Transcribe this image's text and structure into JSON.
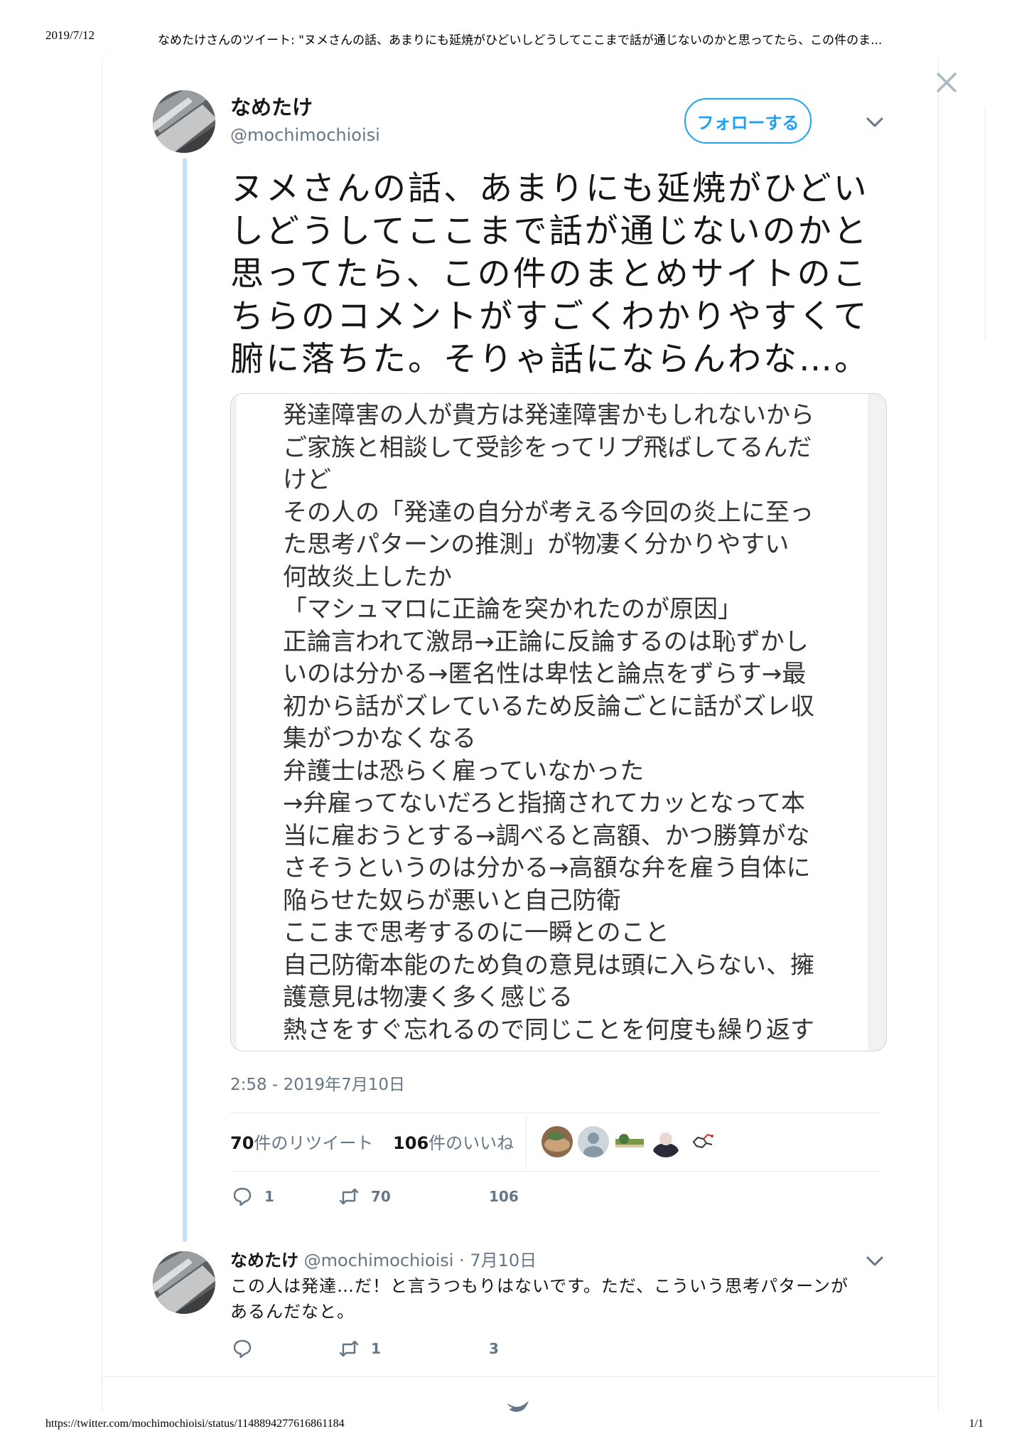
{
  "print_header": {
    "date": "2019/7/12",
    "title": "なめたけさんのツイート: \"ヌメさんの話、あまりにも延焼がひどいしどうしてここまで話が通じないのかと思ってたら、この件のま..."
  },
  "print_footer": {
    "url": "https://twitter.com/mochimochioisi/status/1148894277616861184",
    "page": "1/1"
  },
  "tweet": {
    "display_name": "なめたけ",
    "handle": "@mochimochioisi",
    "follow_label": "フォローする",
    "text_lines": [
      "ヌメさんの話、あまりにも延焼がひどい",
      "しどうしてここまで話が通じないのかと",
      "思ってたら、この件のまとめサイトのこ",
      "ちらのコメントがすごくわかりやすくて",
      "腑に落ちた。そりゃ話にならんわな…。"
    ],
    "image_text_lines": [
      "発達障害の人が貴方は発達障害かもしれないから",
      "ご家族と相談して受診をってリプ飛ばしてるんだ",
      "けど",
      "その人の「発達の自分が考える今回の炎上に至っ",
      "た思考パターンの推測」が物凄く分かりやすい",
      "何故炎上したか",
      "「マシュマロに正論を突かれたのが原因」",
      "正論言われて激昂→正論に反論するのは恥ずかし",
      "いのは分かる→匿名性は卑怯と論点をずらす→最",
      "初から話がズレているため反論ごとに話がズレ収",
      "集がつかなくなる",
      "弁護士は恐らく雇っていなかった",
      "→弁雇ってないだろと指摘されてカッとなって本",
      "当に雇おうとする→調べると高額、かつ勝算がな",
      "さそうというのは分かる→高額な弁を雇う自体に",
      "陥らせた奴らが悪いと自己防衛",
      "ここまで思考するのに一瞬とのこと",
      "自己防衛本能のため負の意見は頭に入らない、擁",
      "護意見は物凄く多く感じる",
      "熱さをすぐ忘れるので同じことを何度も繰り返す"
    ],
    "timestamp": "2:58 - 2019年7月10日",
    "retweet_count": "70",
    "retweet_suffix": "件のリツイート",
    "like_count": "106",
    "like_suffix": "件のいいね",
    "actions": {
      "reply": "1",
      "retweet": "70",
      "like": "106"
    }
  },
  "reply": {
    "display_name": "なめたけ",
    "handle_date": "@mochimochioisi · 7月10日",
    "text_lines": [
      "この人は発達…だ！と言うつもりはないです。ただ、こういう思考パターンが",
      "あるんだなと。"
    ],
    "actions": {
      "reply": "",
      "retweet": "1",
      "like": "3"
    }
  },
  "colors": {
    "accent": "#1da1f2",
    "thread_line": "#c5dff7",
    "secondary_text": "#657786",
    "primary_text": "#14171a"
  },
  "icons": [
    "close-icon",
    "chevron-down-icon",
    "reply-icon",
    "retweet-icon",
    "twitter-bird-icon"
  ]
}
